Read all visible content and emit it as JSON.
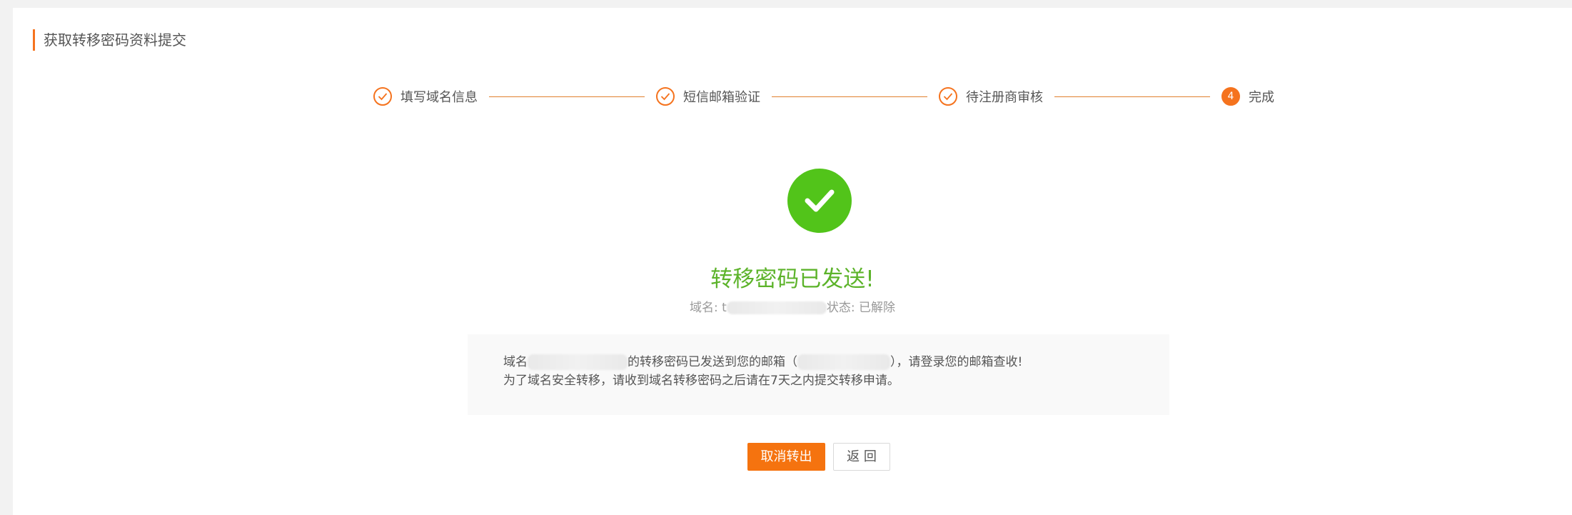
{
  "page": {
    "title": "获取转移密码资料提交"
  },
  "steps": [
    {
      "label": "填写域名信息",
      "state": "done"
    },
    {
      "label": "短信邮箱验证",
      "state": "done"
    },
    {
      "label": "待注册商审核",
      "state": "done"
    },
    {
      "label": "完成",
      "number": "4",
      "state": "active"
    }
  ],
  "result": {
    "title": "转移密码已发送!",
    "domain_prefix": "域名: t",
    "status_text": "状态: 已解除",
    "line1_prefix": "域名",
    "line1_middle": "的转移密码已发送到您的邮箱（",
    "line1_suffix": "），请登录您的邮箱查收!",
    "line2": "为了域名安全转移，请收到域名转移密码之后请在7天之内提交转移申请。"
  },
  "buttons": {
    "cancel_transfer": "取消转出",
    "back": "返 回"
  },
  "colors": {
    "accent": "#f5731e",
    "success": "#52c41a",
    "success_text": "#5cb32a"
  },
  "icons": {
    "step_done": "check-circle-outline-icon",
    "success": "check-circle-filled-icon"
  }
}
